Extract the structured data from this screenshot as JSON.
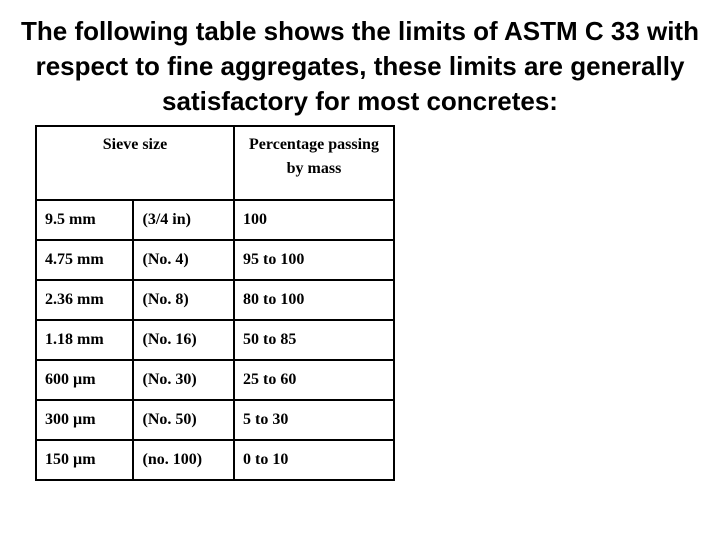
{
  "title": "The following table shows the limits of ASTM C 33 with respect to fine aggregates, these limits are generally satisfactory for most concretes:",
  "table": {
    "headers": {
      "sieve_size": "Sieve size",
      "percentage": "Percentage passing by mass"
    },
    "rows": [
      {
        "metric": "9.5 mm",
        "us": "(3/4 in)",
        "passing": "100"
      },
      {
        "metric": "4.75 mm",
        "us": "(No. 4)",
        "passing": "95 to 100"
      },
      {
        "metric": "2.36 mm",
        "us": "(No. 8)",
        "passing": "80 to 100"
      },
      {
        "metric": "1.18 mm",
        "us": "(No. 16)",
        "passing": "50 to 85"
      },
      {
        "metric": "600 µm",
        "us": "(No. 30)",
        "passing": "25 to 60"
      },
      {
        "metric": "300 µm",
        "us": "(No. 50)",
        "passing": "5 to 30"
      },
      {
        "metric": "150 µm",
        "us": "(no. 100)",
        "passing": "0 to 10"
      }
    ]
  }
}
